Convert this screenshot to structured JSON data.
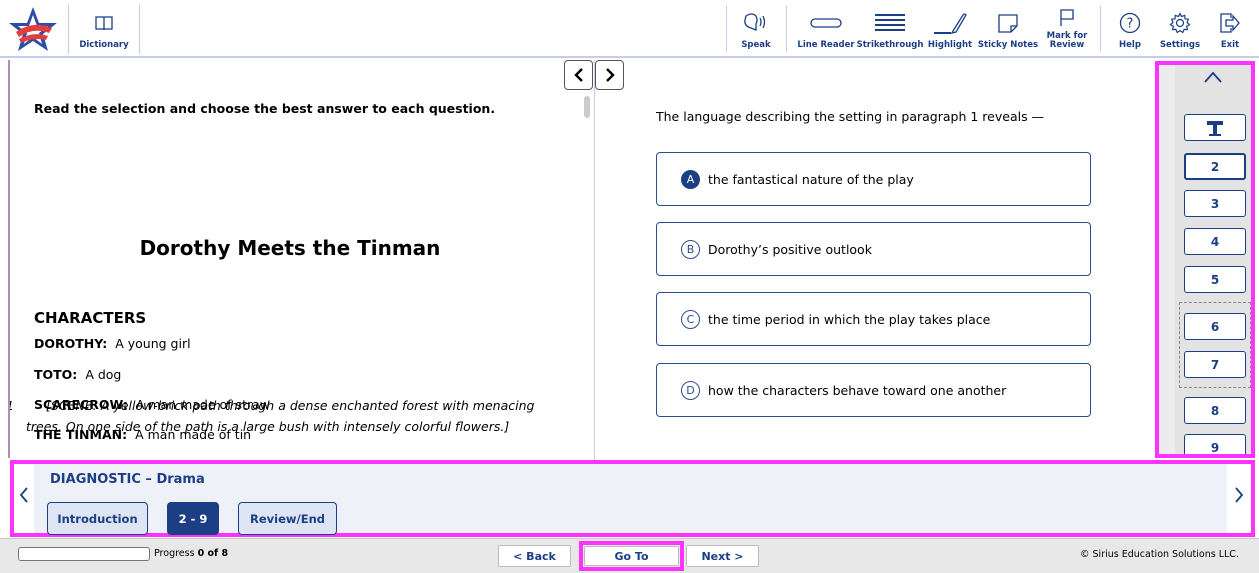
{
  "toolbar": {
    "dictionary": "Dictionary",
    "speak": "Speak",
    "line_reader": "Line Reader",
    "strikethrough": "Strikethrough",
    "highlight": "Highlight",
    "sticky_notes": "Sticky Notes",
    "mark_for_review_1": "Mark for",
    "mark_for_review_2": "Review",
    "help": "Help",
    "settings": "Settings",
    "exit": "Exit"
  },
  "passage": {
    "instructions": "Read the selection and choose the best answer to each question.",
    "title": "Dorothy Meets the Tinman",
    "characters_heading": "CHARACTERS",
    "characters": [
      {
        "name": "DOROTHY:",
        "desc": "A young girl"
      },
      {
        "name": "TOTO:",
        "desc": "A dog"
      },
      {
        "name": "SCARECROW:",
        "desc": "A man made of straw"
      },
      {
        "name": "THE TINMAN:",
        "desc": "A man made of tin"
      }
    ],
    "paragraph_number": "1",
    "scene_line1": "[SCENE: A yellow-brick path through a dense enchanted forest with menacing",
    "scene_line2": "trees. On one side of the path is a large bush with intensely colorful flowers.]"
  },
  "question": {
    "prompt": "The language describing the setting in paragraph 1 reveals —",
    "choices": [
      {
        "letter": "A",
        "text": "the fantastical nature of the play",
        "selected": true
      },
      {
        "letter": "B",
        "text": "Dorothy’s positive outlook",
        "selected": false
      },
      {
        "letter": "C",
        "text": "the time period in which the play takes place",
        "selected": false
      },
      {
        "letter": "D",
        "text": "how the characters behave toward one another",
        "selected": false
      }
    ]
  },
  "question_nav": {
    "items": [
      "2",
      "3",
      "4",
      "5",
      "6",
      "7",
      "8",
      "9"
    ],
    "current": "2"
  },
  "section": {
    "title": "DIAGNOSTIC – Drama",
    "tabs": [
      "Introduction",
      "2 - 9",
      "Review/End"
    ],
    "active_tab": "2 - 9"
  },
  "footer": {
    "progress_prefix": "Progress",
    "progress_count": "0 of 8",
    "progress_fraction": 0,
    "back": "< Back",
    "goto": "Go To",
    "next": "Next >",
    "copyright": "© Sirius Education Solutions LLC."
  },
  "colors": {
    "brand_navy": "#1b3e84",
    "highlight_outline": "#ff33ff"
  }
}
